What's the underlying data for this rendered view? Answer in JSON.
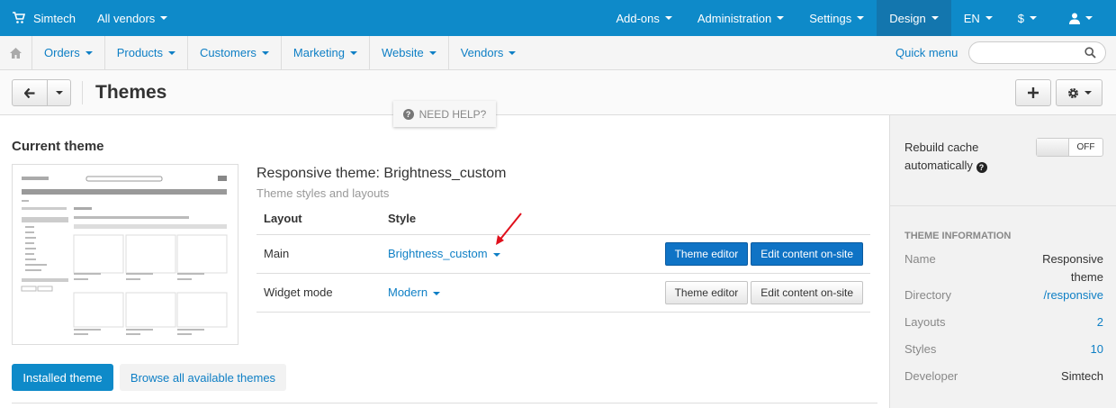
{
  "topbar": {
    "brand": "Simtech",
    "vendors": "All vendors",
    "nav": [
      "Add-ons",
      "Administration",
      "Settings",
      "Design",
      "EN",
      "$"
    ],
    "active": "Design"
  },
  "subnav": {
    "items": [
      "Orders",
      "Products",
      "Customers",
      "Marketing",
      "Website",
      "Vendors"
    ],
    "quick_menu": "Quick menu",
    "search_placeholder": ""
  },
  "page": {
    "title": "Themes",
    "need_help": "NEED HELP?"
  },
  "current_theme": {
    "section_title": "Current theme",
    "theme_name": "Responsive theme: Brightness_custom",
    "subtitle": "Theme styles and layouts",
    "table": {
      "headers": [
        "Layout",
        "Style"
      ],
      "rows": [
        {
          "layout": "Main",
          "style": "Brightness_custom",
          "theme_editor": "Theme editor",
          "edit_content": "Edit content on-site",
          "primary": true
        },
        {
          "layout": "Widget mode",
          "style": "Modern",
          "theme_editor": "Theme editor",
          "edit_content": "Edit content on-site",
          "primary": false
        }
      ]
    },
    "installed_btn": "Installed theme",
    "browse_btn": "Browse all available themes"
  },
  "sidebar": {
    "rebuild_label": "Rebuild cache automatically",
    "toggle": "OFF",
    "info_heading": "THEME INFORMATION",
    "info": [
      {
        "k": "Name",
        "v": "Responsive theme",
        "link": false
      },
      {
        "k": "Directory",
        "v": "/responsive",
        "link": true
      },
      {
        "k": "Layouts",
        "v": "2",
        "link": true
      },
      {
        "k": "Styles",
        "v": "10",
        "link": true
      },
      {
        "k": "Developer",
        "v": "Simtech",
        "link": false
      }
    ]
  },
  "colors": {
    "primary": "#0e8ac9",
    "link": "#0e7fc5",
    "annotation_arrow": "#e0101c"
  }
}
